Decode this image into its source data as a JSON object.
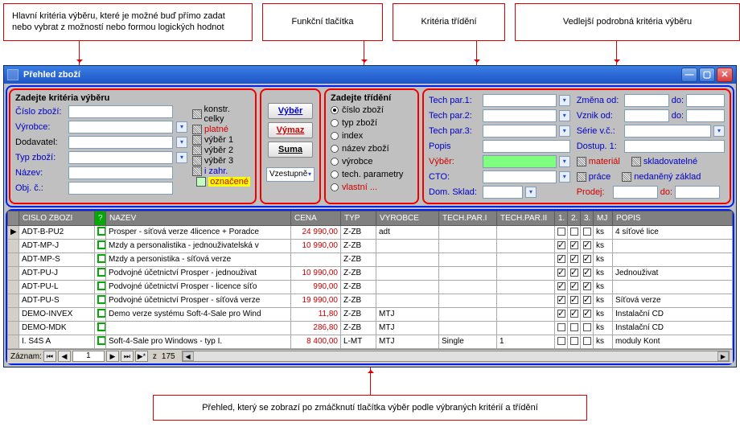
{
  "annotations": {
    "main": "Hlavní kritéria výběru, které je možné buď přímo zadat nebo vybrat z možností nebo formou logických hodnot",
    "buttons": "Funkční tlačítka",
    "sort": "Kritéria třídění",
    "detail": "Vedlejší podrobná kritéria výběru",
    "bottom": "Přehled, který se zobrazí po zmáčknutí tlačítka výběr podle výbraných kritérií a třídění"
  },
  "window": {
    "title": "Přehled zboží"
  },
  "criteria": {
    "title": "Zadejte kritéria výběru",
    "fields": {
      "code": "Číslo zboží:",
      "vendor": "Výrobce:",
      "supplier": "Dodavatel:",
      "type": "Typ zboží:",
      "name": "Název:",
      "objc": "Obj. č.:"
    },
    "checks": {
      "konstr": "konstr. celky",
      "platne": "platné",
      "v1": "výběr 1",
      "v2": "výběr 2",
      "v3": "výběr 3",
      "izahr": "i zahr.",
      "oznacene": "označené"
    }
  },
  "buttons": {
    "vyber": "Výběr",
    "vymaz": "Výmaz",
    "suma": "Suma",
    "order": "Vzestupně"
  },
  "sort": {
    "title": "Zadejte třídění",
    "options": [
      "číslo zboží",
      "typ zboží",
      "index",
      "název zboží",
      "výrobce",
      "tech. parametry",
      "vlastní ..."
    ],
    "selected": 0
  },
  "detail": {
    "tp1": "Tech par.1:",
    "tp2": "Tech par.2:",
    "tp3": "Tech par.3:",
    "popis": "Popis",
    "vyber": "Výběr:",
    "cto": "CTO:",
    "domsklad": "Dom. Sklad:",
    "zmena": "Změna od:",
    "vznik": "Vznik od:",
    "serie": "Série v.č.:",
    "dostup": "Dostup. 1:",
    "material": "materiál",
    "prace": "práce",
    "sklad": "skladovatelné",
    "nedan": "nedaněný základ",
    "prodej": "Prodej:",
    "do": "do:"
  },
  "grid": {
    "headers": [
      "CISLO ZBOZI",
      "?",
      "NAZEV",
      "CENA",
      "TYP",
      "VYROBCE",
      "TECH.PAR.I",
      "TECH.PAR.II",
      "1.",
      "2.",
      "3.",
      "MJ",
      "POPIS"
    ],
    "rows": [
      {
        "sel": "▶",
        "code": "ADT-B-PU2",
        "name": "Prosper - síťová verze 4licence + Poradce",
        "price": "24 990,00",
        "typ": "Z-ZB",
        "vyr": "adt",
        "tp1": "",
        "tp2": "",
        "c1": false,
        "c2": false,
        "c3": false,
        "mj": "ks",
        "popis": "4 síťové lice"
      },
      {
        "sel": "",
        "code": "ADT-MP-J",
        "name": "Mzdy a personalistika - jednouživatelská v",
        "price": "10 990,00",
        "typ": "Z-ZB",
        "vyr": "",
        "tp1": "",
        "tp2": "",
        "c1": true,
        "c2": true,
        "c3": true,
        "mj": "ks",
        "popis": ""
      },
      {
        "sel": "",
        "code": "ADT-MP-S",
        "name": "Mzdy a personistika - síťová verze",
        "price": "",
        "typ": "Z-ZB",
        "vyr": "",
        "tp1": "",
        "tp2": "",
        "c1": true,
        "c2": true,
        "c3": true,
        "mj": "ks",
        "popis": ""
      },
      {
        "sel": "",
        "code": "ADT-PU-J",
        "name": "Podvojné účetnictví Prosper - jednouživat",
        "price": "10 990,00",
        "typ": "Z-ZB",
        "vyr": "",
        "tp1": "",
        "tp2": "",
        "c1": true,
        "c2": true,
        "c3": true,
        "mj": "ks",
        "popis": "Jednouživat"
      },
      {
        "sel": "",
        "code": "ADT-PU-L",
        "name": "Podvojné účetnictví Prosper - licence síťo",
        "price": "990,00",
        "typ": "Z-ZB",
        "vyr": "",
        "tp1": "",
        "tp2": "",
        "c1": true,
        "c2": true,
        "c3": true,
        "mj": "ks",
        "popis": ""
      },
      {
        "sel": "",
        "code": "ADT-PU-S",
        "name": "Podvojné účetnictví Prosper - síťová verze",
        "price": "19 990,00",
        "typ": "Z-ZB",
        "vyr": "",
        "tp1": "",
        "tp2": "",
        "c1": true,
        "c2": true,
        "c3": true,
        "mj": "ks",
        "popis": "Síťová verze"
      },
      {
        "sel": "",
        "code": "DEMO-INVEX",
        "name": "Demo verze systému Soft-4-Sale pro Wind",
        "price": "11,80",
        "typ": "Z-ZB",
        "vyr": "MTJ",
        "tp1": "",
        "tp2": "",
        "c1": true,
        "c2": true,
        "c3": true,
        "mj": "ks",
        "popis": "Instalační CD"
      },
      {
        "sel": "",
        "code": "DEMO-MDK",
        "name": "",
        "price": "286,80",
        "typ": "Z-ZB",
        "vyr": "MTJ",
        "tp1": "",
        "tp2": "",
        "c1": false,
        "c2": false,
        "c3": false,
        "mj": "ks",
        "popis": "Instalační CD"
      },
      {
        "sel": "",
        "code": "I. S4S A",
        "name": "Soft-4-Sale pro Windows - typ I.",
        "price": "8 400,00",
        "typ": "L-MT",
        "vyr": "MTJ",
        "tp1": "Single",
        "tp2": "1",
        "c1": false,
        "c2": false,
        "c3": false,
        "mj": "ks",
        "popis": "moduly Kont"
      }
    ]
  },
  "record": {
    "label": "Záznam:",
    "current": "1",
    "of_prefix": "z",
    "total": "175"
  }
}
